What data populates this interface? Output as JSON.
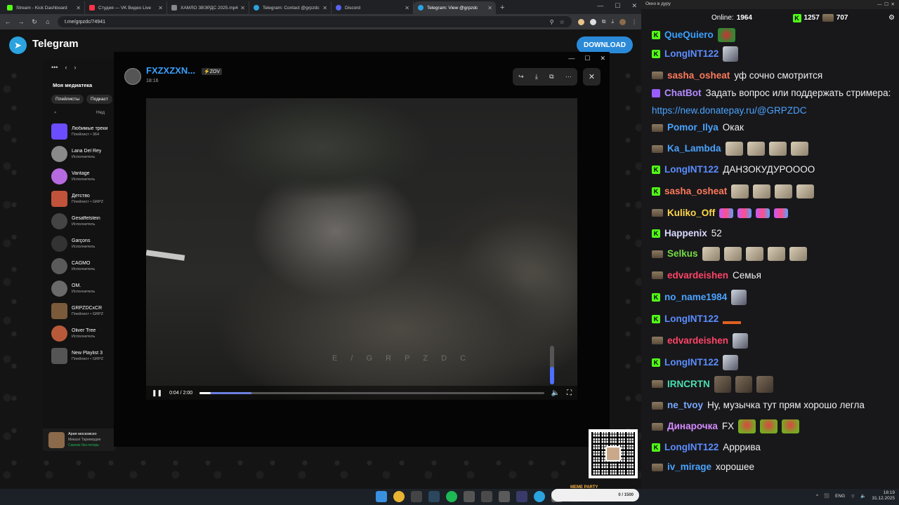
{
  "browser": {
    "tabs": [
      {
        "title": "Stream - Kick Dashboard",
        "color": "#53fc18"
      },
      {
        "title": "Студия — VK Видео Live",
        "color": "#ff3347"
      },
      {
        "title": "ХАМЛО ЗВЭРДС 2025.mp4",
        "color": "#888888"
      },
      {
        "title": "Telegram: Contact @grpzdc",
        "color": "#2aa3df"
      },
      {
        "title": "Discord",
        "color": "#5865f2"
      },
      {
        "title": "Telegram: View @grpzdc",
        "color": "#2aa3df"
      }
    ],
    "url": "t.me/grpzdc/74941"
  },
  "telegram": {
    "brand": "Telegram",
    "download_label": "DOWNLOAD"
  },
  "music": {
    "title": "Моя медиатека",
    "chips": [
      "Плейлисты",
      "Подкаст"
    ],
    "search_hint": "Нед",
    "items": [
      {
        "name": "Любимые треки",
        "sub": "Плейлист • 364",
        "color": "#6b4cff"
      },
      {
        "name": "Lana Del Rey",
        "sub": "Исполнитель",
        "color": "#8a8a8a"
      },
      {
        "name": "Vantage",
        "sub": "Исполнитель",
        "color": "#b66adf"
      },
      {
        "name": "Детство",
        "sub": "Плейлист • GRPZ",
        "color": "#c0533a"
      },
      {
        "name": "Gesaffelstein",
        "sub": "Исполнитель",
        "color": "#444444"
      },
      {
        "name": "Garçons",
        "sub": "Исполнитель",
        "color": "#333333"
      },
      {
        "name": "CAGMO",
        "sub": "Исполнитель",
        "color": "#5a5a5a"
      },
      {
        "name": "OM.",
        "sub": "Исполнитель",
        "color": "#6a6a6a"
      },
      {
        "name": "GRPZDCxCR",
        "sub": "Плейлист • GRPZ",
        "color": "#7a5a3a"
      },
      {
        "name": "Oliver Tree",
        "sub": "Исполнитель",
        "color": "#b85a3a"
      },
      {
        "name": "New Playlist 3",
        "sub": "Плейлист • GRPZ",
        "color": "#555555"
      }
    ],
    "now_playing": {
      "name": "Ария московско",
      "sub": "Микаэл Таривердие",
      "extra": "Сжатие без потерь"
    }
  },
  "viewer": {
    "channel": "FXZXZXN...",
    "badge": "⚡ZOV",
    "time": "18:16",
    "watermark": "E / G R P Z D C",
    "position": "0:04",
    "duration": "2:00",
    "played_fraction": 0.033,
    "buffered_fraction": 0.15,
    "volume_fraction": 0.45
  },
  "chat": {
    "window_title": "Окно в дуру",
    "online_label": "Online:",
    "online": "1964",
    "kick_count": "1257",
    "other_count": "707",
    "messages": [
      {
        "user": "QueQuiero",
        "color": "#3aa0ff",
        "text": "",
        "emotes": [
          "frog"
        ]
      },
      {
        "user": "LongINT122",
        "color": "#5b8dff",
        "text": "",
        "emotes": [
          "man"
        ]
      },
      {
        "user": "sasha_osheat",
        "color": "#ff7a5a",
        "text": "уф сочно смотрится",
        "emotes": []
      },
      {
        "user": "ChatBot",
        "color": "#b58cff",
        "text": "Задать вопрос или поддержать стримера:",
        "link": "https://new.donatepay.ru/@GRPZDC",
        "emotes": []
      },
      {
        "user": "Pomor_Ilya",
        "color": "#4aa3ff",
        "text": "Окак",
        "emotes": []
      },
      {
        "user": "Ka_Lambda",
        "color": "#4aa3ff",
        "text": "",
        "emotes": [
          "cat",
          "cat",
          "cat",
          "cat"
        ]
      },
      {
        "user": "LongINT122",
        "color": "#5b8dff",
        "text": "ДАНЗОКУДУРОООО",
        "emotes": []
      },
      {
        "user": "sasha_osheat",
        "color": "#ff7a5a",
        "text": "",
        "emotes": [
          "cat",
          "cat",
          "cat",
          "cat"
        ]
      },
      {
        "user": "Kuliko_Off",
        "color": "#ffd84a",
        "text": "",
        "emotes": [
          "wave",
          "wave",
          "wave",
          "wave"
        ]
      },
      {
        "user": "Happenix",
        "color": "#d9d9ff",
        "text": "52",
        "emotes": []
      },
      {
        "user": "Selkus",
        "color": "#77dd44",
        "text": "",
        "emotes": [
          "cat",
          "cat",
          "cat",
          "cat",
          "cat"
        ]
      },
      {
        "user": "edvardeishen",
        "color": "#ff4466",
        "text": "Семья",
        "emotes": []
      },
      {
        "user": "no_name1984",
        "color": "#4aa3ff",
        "text": "",
        "emotes": [
          "man"
        ]
      },
      {
        "user": "LongINT122",
        "color": "#5b8dff",
        "text": "",
        "emotes": [
          "dots"
        ]
      },
      {
        "user": "edvardeishen",
        "color": "#ff4466",
        "text": "",
        "emotes": [
          "man"
        ]
      },
      {
        "user": "LongINT122",
        "color": "#5b8dff",
        "text": "",
        "emotes": [
          "man"
        ]
      },
      {
        "user": "IRNCRTN",
        "color": "#4adfb0",
        "text": "",
        "emotes": [
          "sq",
          "sq",
          "sq"
        ]
      },
      {
        "user": "ne_tvoy",
        "color": "#7aa8ff",
        "text": "Ну, музычка тут прям хорошо легла",
        "emotes": []
      },
      {
        "user": "Динарочка",
        "color": "#d58cff",
        "text": "FX",
        "emotes": [
          "red",
          "red",
          "red"
        ]
      },
      {
        "user": "LongINT122",
        "color": "#5b8dff",
        "text": "Арррива",
        "emotes": []
      },
      {
        "user": "iv_mirage",
        "color": "#4aa3ff",
        "text": "хорошее",
        "emotes": []
      }
    ]
  },
  "taskbar": {
    "meme_label": "MEME PARTY",
    "meme_progress": "0 / 1500",
    "lang": "ENG",
    "time": "18:19",
    "date": "31.12.2025"
  }
}
